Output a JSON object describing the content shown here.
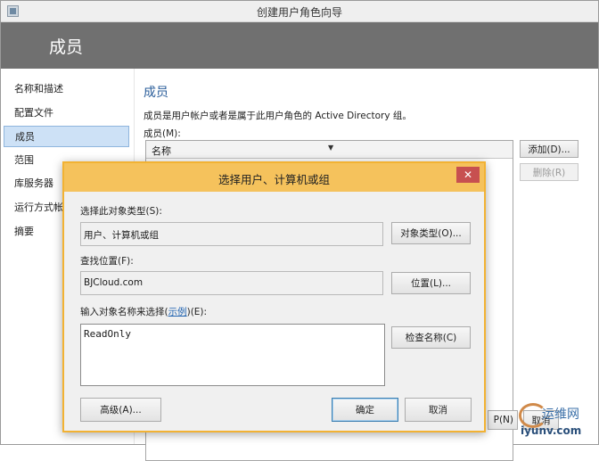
{
  "window": {
    "title": "创建用户角色向导",
    "banner": "成员"
  },
  "nav": {
    "items": [
      "名称和描述",
      "配置文件",
      "成员",
      "范围",
      "库服务器",
      "运行方式帐户",
      "摘要"
    ]
  },
  "main": {
    "heading": "成员",
    "description": "成员是用户帐户或者是属于此用户角色的 Active Directory 组。",
    "members_label": "成员(M):",
    "column_name": "名称",
    "add_button": "添加(D)...",
    "remove_button": "删除(R)",
    "next_button_partial": "P(N)",
    "cancel_partial": "取消"
  },
  "dialog": {
    "title": "选择用户、计算机或组",
    "close_glyph": "✕",
    "object_type_label": "选择此对象类型(S):",
    "object_type_value": "用户、计算机或组",
    "object_type_button": "对象类型(O)...",
    "location_label": "查找位置(F):",
    "location_value": "BJCloud.com",
    "location_button": "位置(L)...",
    "names_label_prefix": "输入对象名称来选择(",
    "names_label_link": "示例",
    "names_label_suffix": ")(E):",
    "names_value": "ReadOnly",
    "check_names_button": "检查名称(C)",
    "advanced_button": "高级(A)...",
    "ok_button": "确定",
    "cancel_button": "取消"
  },
  "watermark": {
    "line1": "运维网",
    "line2": "iyunv.com"
  }
}
